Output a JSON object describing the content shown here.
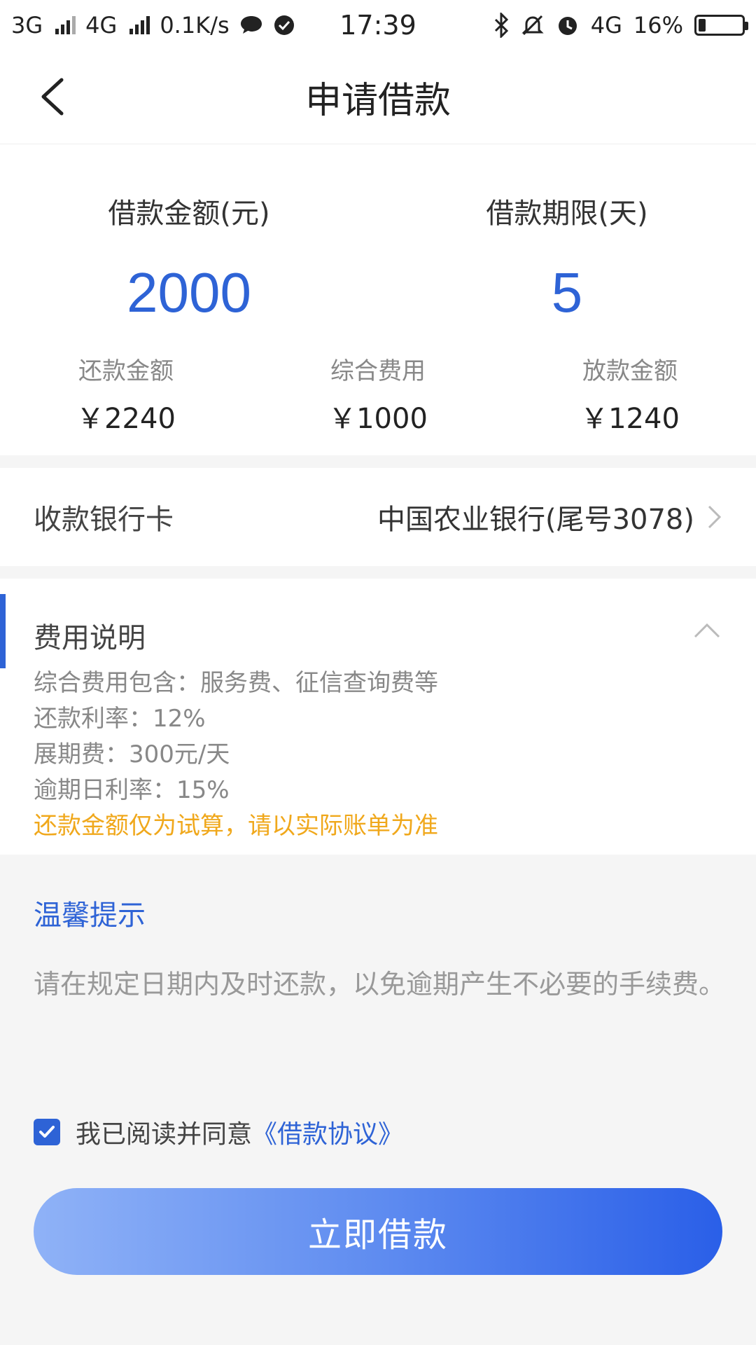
{
  "status_bar": {
    "net1": "3G",
    "net2": "4G",
    "speed": "0.1K/s",
    "time": "17:39",
    "net3": "4G",
    "battery_text": "16%",
    "battery_level": 0.16
  },
  "nav": {
    "title": "申请借款"
  },
  "summary": {
    "amount_label": "借款金额(元)",
    "amount_value": "2000",
    "term_label": "借款期限(天)",
    "term_value": "5",
    "repay_label": "还款金额",
    "repay_value": "￥2240",
    "fee_label": "综合费用",
    "fee_value": "￥1000",
    "disburse_label": "放款金额",
    "disburse_value": "￥1240"
  },
  "bank": {
    "label": "收款银行卡",
    "value": "中国农业银行(尾号3078)"
  },
  "fee_section": {
    "title": "费用说明",
    "lines": [
      "综合费用包含：服务费、征信查询费等",
      "还款利率：12%",
      "展期费：300元/天",
      "逾期日利率：15%"
    ],
    "warning": "还款金额仅为试算，请以实际账单为准"
  },
  "tips": {
    "title": "温馨提示",
    "text": "请在规定日期内及时还款，以免逾期产生不必要的手续费。"
  },
  "agreement": {
    "checked": true,
    "text": "我已阅读并同意",
    "link": "《借款协议》"
  },
  "submit": {
    "label": "立即借款"
  },
  "colors": {
    "accent": "#2e63d6",
    "warning": "#f0a81c"
  }
}
